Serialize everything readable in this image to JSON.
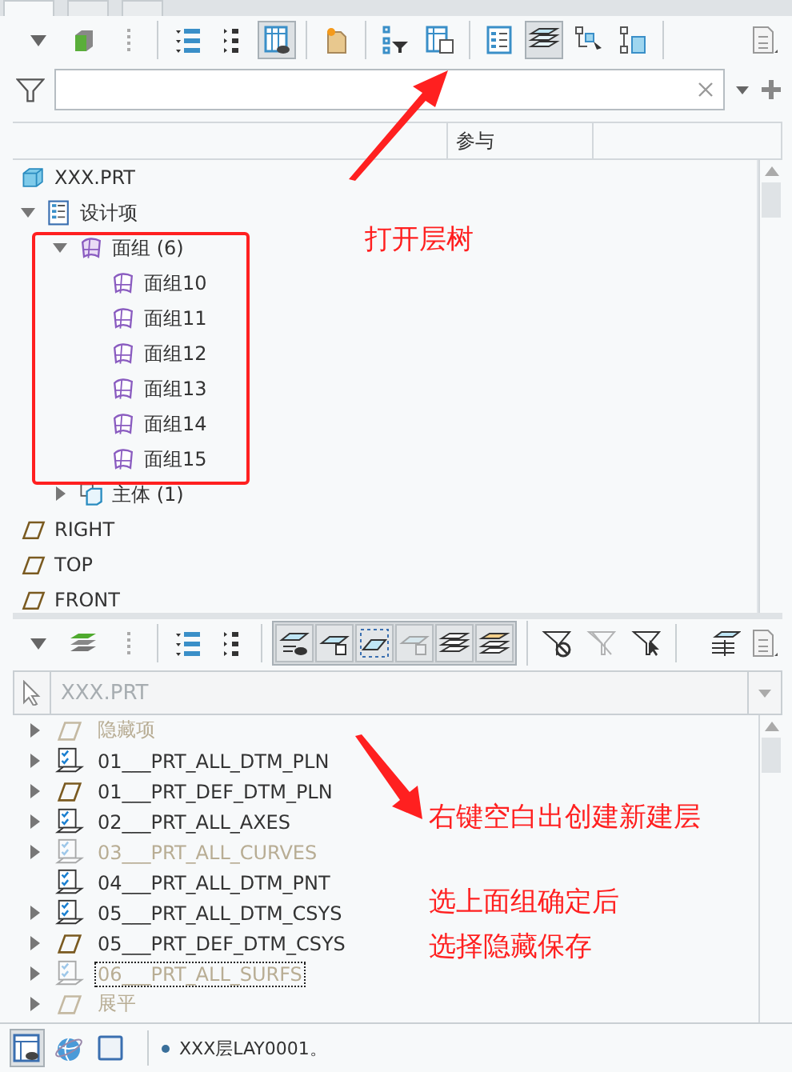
{
  "panel_tabs": [
    {
      "selected": true
    },
    {
      "selected": false
    },
    {
      "selected": false
    }
  ],
  "model_tree": {
    "toolbar": {
      "groups": [
        [
          {
            "kind": "caret",
            "selected": false
          },
          {
            "kind": "cube",
            "selected": false
          },
          {
            "kind": "grip",
            "selected": false
          }
        ],
        [
          {
            "kind": "list-tree",
            "selected": false
          },
          {
            "kind": "list-dots",
            "selected": false
          },
          {
            "kind": "columns-eye",
            "selected": true
          }
        ],
        [
          {
            "kind": "folder-star",
            "selected": false
          }
        ],
        [
          {
            "kind": "tree-filter",
            "selected": false
          },
          {
            "kind": "table-doc",
            "selected": false
          }
        ],
        [
          {
            "kind": "checklist",
            "selected": false
          },
          {
            "kind": "layers",
            "selected": true
          },
          {
            "kind": "tree-pointer",
            "selected": false
          },
          {
            "kind": "tree-box",
            "selected": false
          }
        ]
      ],
      "right": [
        {
          "kind": "doc-settings",
          "selected": false
        }
      ]
    },
    "columns": [
      "参与"
    ],
    "items": [
      {
        "label": "XXX.PRT",
        "kind": "part"
      },
      {
        "label": "设计项",
        "kind": "features",
        "expanded": true,
        "children": [
          {
            "label": "面组 (6)",
            "kind": "quilt-group",
            "expanded": true,
            "children": [
              {
                "label": "面组10",
                "kind": "quilt"
              },
              {
                "label": "面组11",
                "kind": "quilt"
              },
              {
                "label": "面组12",
                "kind": "quilt"
              },
              {
                "label": "面组13",
                "kind": "quilt"
              },
              {
                "label": "面组14",
                "kind": "quilt"
              },
              {
                "label": "面组15",
                "kind": "quilt"
              }
            ]
          },
          {
            "label": "主体 (1)",
            "kind": "body",
            "expanded": false
          }
        ]
      },
      {
        "label": "RIGHT",
        "kind": "plane"
      },
      {
        "label": "TOP",
        "kind": "plane"
      },
      {
        "label": "FRONT",
        "kind": "plane"
      }
    ]
  },
  "layer_tree": {
    "toolbar": {
      "groups": [
        [
          {
            "kind": "caret",
            "disabled": false
          },
          {
            "kind": "layers-green",
            "disabled": false
          },
          {
            "kind": "grip",
            "disabled": false
          }
        ],
        [
          {
            "kind": "list-tree",
            "disabled": false
          },
          {
            "kind": "list-dots",
            "disabled": false
          }
        ],
        [
          {
            "kind": "layer-eye",
            "disabled": false
          },
          {
            "kind": "layer-box",
            "disabled": false
          },
          {
            "kind": "layer-dashed",
            "disabled": false
          },
          {
            "kind": "layer-box",
            "disabled": true
          },
          {
            "kind": "layers-stack",
            "disabled": false
          },
          {
            "kind": "layers-gold",
            "disabled": false
          }
        ],
        [
          {
            "kind": "filter-no",
            "disabled": false
          },
          {
            "kind": "filter-plain",
            "disabled": true
          },
          {
            "kind": "filter-pointer",
            "disabled": false
          }
        ]
      ],
      "right": [
        {
          "kind": "layers-table",
          "disabled": false
        },
        {
          "kind": "doc-settings",
          "disabled": false
        }
      ]
    },
    "model": {
      "value": "XXX.PRT",
      "disabled": true
    },
    "layers": [
      {
        "label": "隐藏项",
        "kind": "plane",
        "expandable": true,
        "hidden": true,
        "selected": false
      },
      {
        "label": "01___PRT_ALL_DTM_PLN",
        "kind": "layer",
        "expandable": true,
        "hidden": false,
        "selected": false
      },
      {
        "label": "01___PRT_DEF_DTM_PLN",
        "kind": "plane",
        "expandable": true,
        "hidden": false,
        "selected": false
      },
      {
        "label": "02___PRT_ALL_AXES",
        "kind": "layer",
        "expandable": true,
        "hidden": false,
        "selected": false
      },
      {
        "label": "03___PRT_ALL_CURVES",
        "kind": "layer",
        "expandable": true,
        "hidden": true,
        "selected": false
      },
      {
        "label": "04___PRT_ALL_DTM_PNT",
        "kind": "layer",
        "expandable": false,
        "hidden": false,
        "selected": false
      },
      {
        "label": "05___PRT_ALL_DTM_CSYS",
        "kind": "layer",
        "expandable": true,
        "hidden": false,
        "selected": false
      },
      {
        "label": "05___PRT_DEF_DTM_CSYS",
        "kind": "plane",
        "expandable": true,
        "hidden": false,
        "selected": false
      },
      {
        "label": "06___PRT_ALL_SURFS",
        "kind": "layer",
        "expandable": true,
        "hidden": true,
        "selected": true
      },
      {
        "label": "展平",
        "kind": "plane",
        "expandable": true,
        "hidden": true,
        "selected": false
      }
    ]
  },
  "status_bar": {
    "buttons": [
      {
        "kind": "view-eye",
        "selected": true
      },
      {
        "kind": "globe",
        "selected": false
      },
      {
        "kind": "square",
        "selected": false
      }
    ],
    "message": "XXX层LAY0001。"
  },
  "annotations": [
    {
      "kind": "note",
      "text": "打开层树"
    },
    {
      "kind": "note",
      "text": "右键空白出创建新建层"
    },
    {
      "kind": "note",
      "text": "选上面组确定后"
    },
    {
      "kind": "note",
      "text": "选择隐藏保存"
    }
  ]
}
